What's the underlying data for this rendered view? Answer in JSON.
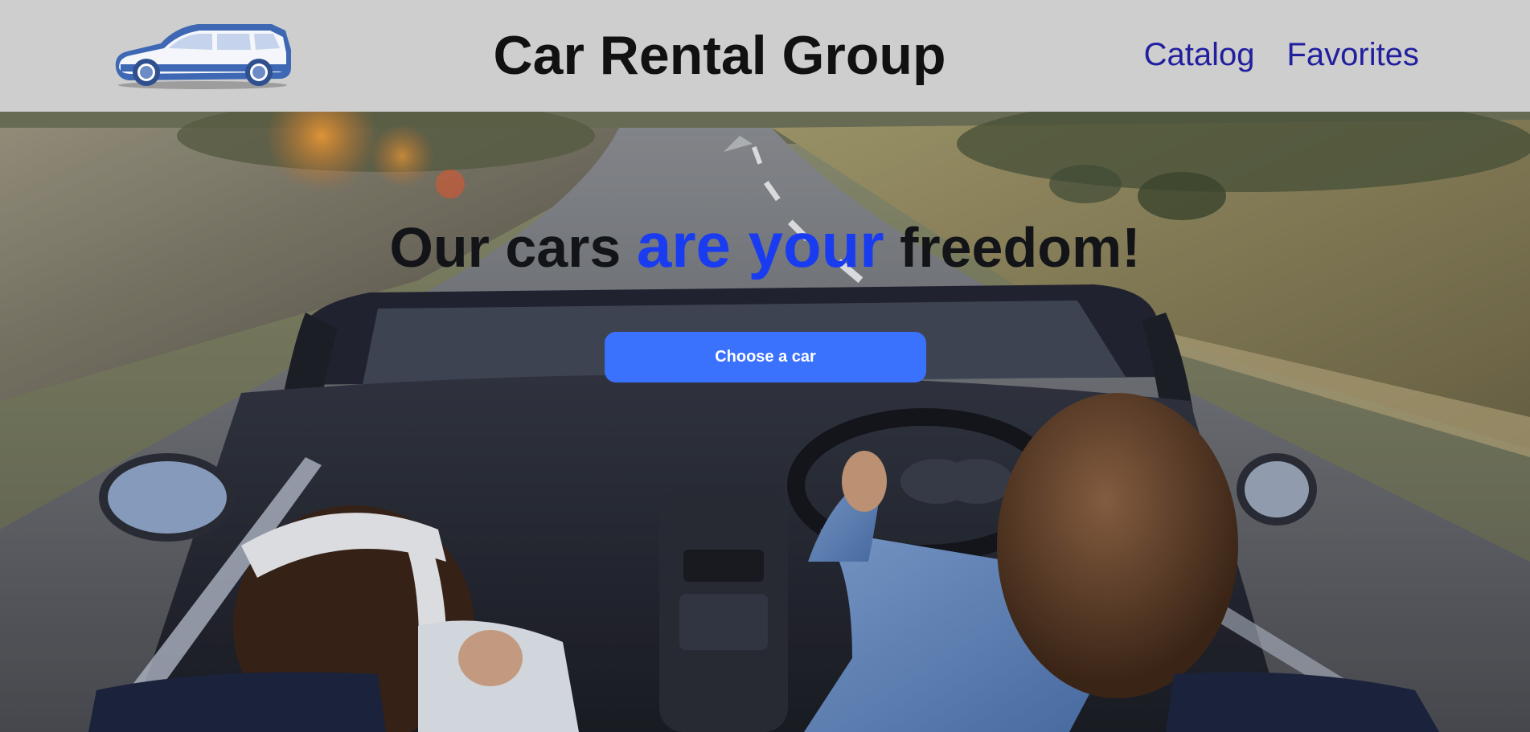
{
  "header": {
    "logo_icon": "car-logo-icon",
    "title": "Car Rental Group",
    "nav": [
      {
        "label": "Catalog"
      },
      {
        "label": "Favorites"
      }
    ],
    "nav_color": "#221f9e"
  },
  "hero": {
    "background": "convertible-on-road-image",
    "title_part1": "Our cars ",
    "title_accent": "are your",
    "title_part2": " freedom!",
    "accent_color": "#1a3cf0",
    "cta_label": "Choose a car",
    "cta_color": "#3b72fd"
  }
}
